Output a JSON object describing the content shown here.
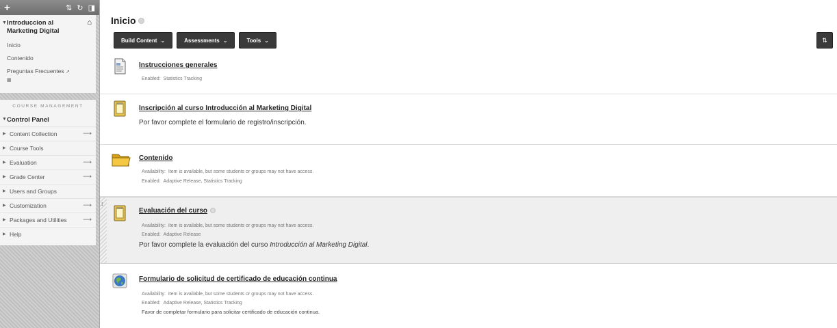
{
  "sidebar": {
    "toolbar": {
      "add": "+",
      "sort_icon": "⇅",
      "refresh_icon": "↻",
      "toggle_icon": "◨"
    },
    "course": {
      "title_line1": "Introduccion al",
      "title_line2": "Marketing Digital",
      "home_icon": "⌂",
      "links": [
        {
          "label": "Inicio"
        },
        {
          "label": "Contenido"
        },
        {
          "label": "Preguntas Frecuentes"
        }
      ]
    },
    "management_label": "COURSE MANAGEMENT",
    "control_panel": {
      "title": "Control Panel",
      "items": [
        {
          "label": "Content Collection",
          "has_arrow": true
        },
        {
          "label": "Course Tools",
          "has_arrow": false
        },
        {
          "label": "Evaluation",
          "has_arrow": true
        },
        {
          "label": "Grade Center",
          "has_arrow": true
        },
        {
          "label": "Users and Groups",
          "has_arrow": false
        },
        {
          "label": "Customization",
          "has_arrow": true
        },
        {
          "label": "Packages and Utilities",
          "has_arrow": true
        },
        {
          "label": "Help",
          "has_arrow": false
        }
      ]
    }
  },
  "main": {
    "title": "Inicio",
    "toolbar": {
      "build_content": "Build Content",
      "assessments": "Assessments",
      "tools": "Tools"
    },
    "items": [
      {
        "title": "Instrucciones generales",
        "icon": "document-icon",
        "meta": [
          {
            "k": "Enabled:",
            "v": "Statistics Tracking"
          }
        ]
      },
      {
        "title": "Inscripción al curso Introducción al Marketing Digital",
        "icon": "survey-icon",
        "description": "Por favor complete el formulario de registro/inscripción."
      },
      {
        "title": "Contenido",
        "icon": "folder-icon",
        "meta": [
          {
            "k": "Availability:",
            "v": "Item is available, but some students or groups may not have access."
          },
          {
            "k": "Enabled:",
            "v": "Adaptive Release, Statistics Tracking"
          }
        ]
      },
      {
        "title": "Evaluación del curso",
        "icon": "survey-icon",
        "meta": [
          {
            "k": "Availability:",
            "v": "Item is available, but some students or groups may not have access."
          },
          {
            "k": "Enabled:",
            "v": "Adaptive Release"
          }
        ],
        "description_prefix": "Por favor complete la evaluación del curso ",
        "description_em": "Introducción al Marketing Digital",
        "description_suffix": "."
      },
      {
        "title": "Formulario de solicitud de certificado de educación continua",
        "icon": "web-link-icon",
        "meta": [
          {
            "k": "Availability:",
            "v": "Item is available, but some students or groups may not have access."
          },
          {
            "k": "Enabled:",
            "v": "Adaptive Release, Statistics Tracking"
          }
        ],
        "description": "Favor de completar formulario para solicitar certificado de educación continua."
      }
    ]
  }
}
